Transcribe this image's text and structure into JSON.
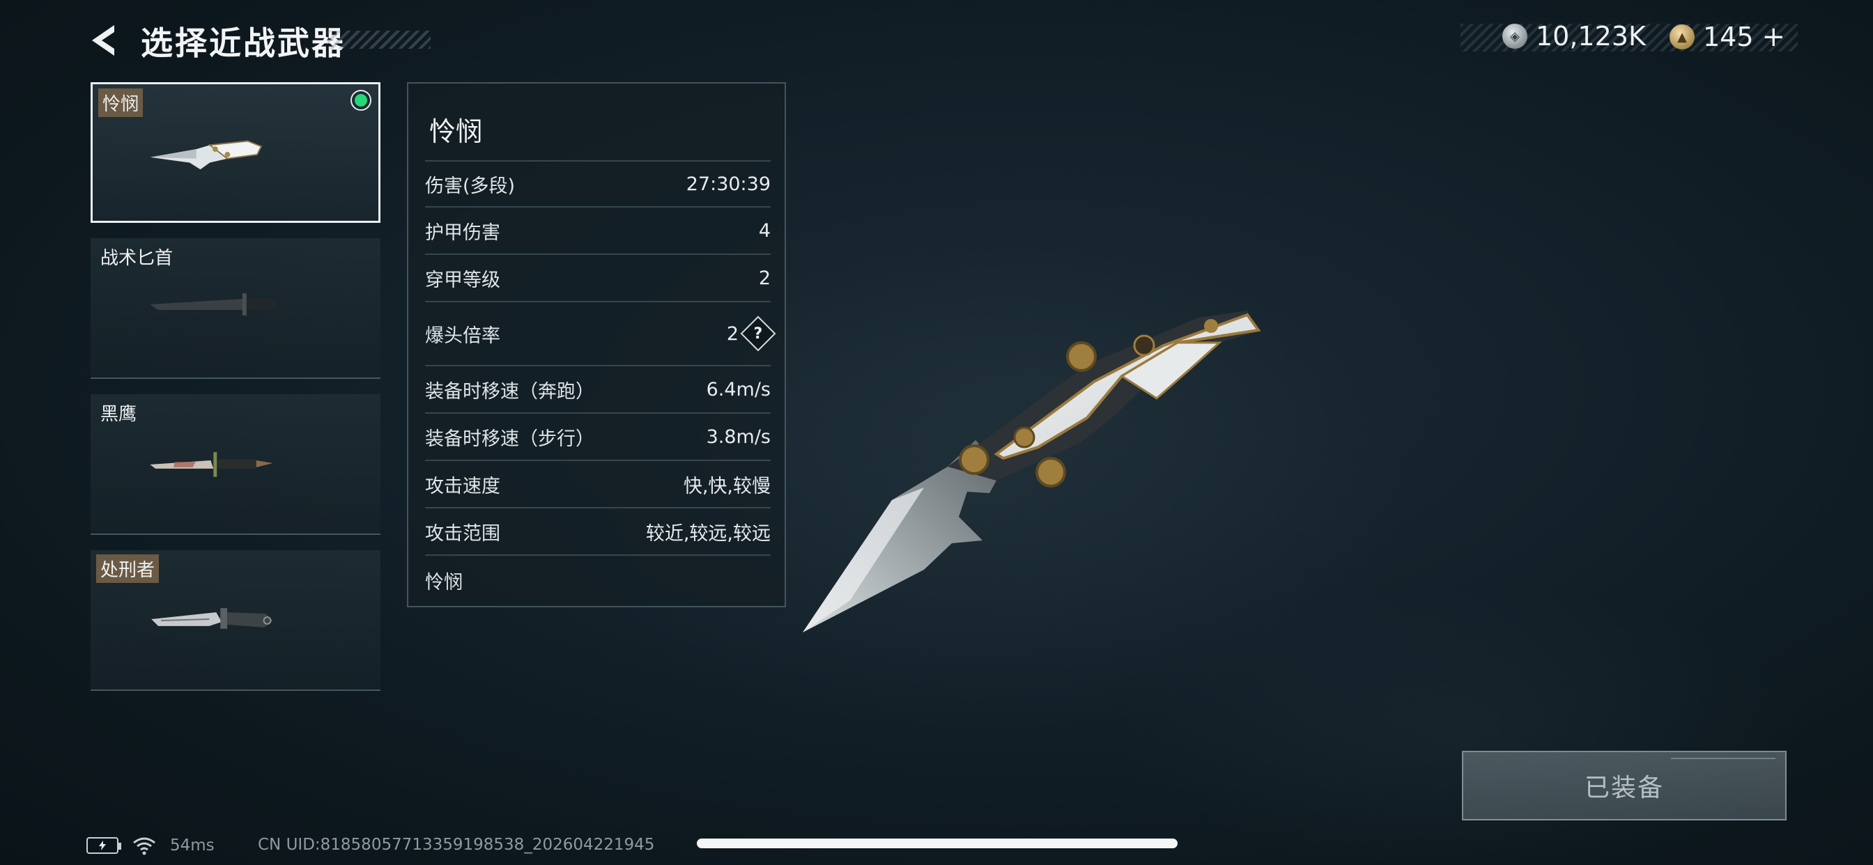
{
  "header": {
    "title": "选择近战武器",
    "back_icon": "back-arrow-icon"
  },
  "currency": {
    "silver": {
      "icon": "silver-coin-icon",
      "amount": "10,123K"
    },
    "gold": {
      "icon": "gold-coin-icon",
      "amount": "145",
      "add_label": "+"
    }
  },
  "weapons": [
    {
      "name": "怜悯",
      "selected": true,
      "equipped": true,
      "tagged": true
    },
    {
      "name": "战术匕首",
      "selected": false,
      "equipped": false,
      "tagged": false
    },
    {
      "name": "黑鹰",
      "selected": false,
      "equipped": false,
      "tagged": false
    },
    {
      "name": "处刑者",
      "selected": false,
      "equipped": false,
      "tagged": true
    }
  ],
  "stats": {
    "name": "怜悯",
    "rows": [
      {
        "label": "伤害(多段)",
        "value": "27:30:39"
      },
      {
        "label": "护甲伤害",
        "value": "4"
      },
      {
        "label": "穿甲等级",
        "value": "2"
      },
      {
        "label": "爆头倍率",
        "value": "2",
        "help": "?"
      },
      {
        "label": "装备时移速（奔跑）",
        "value": "6.4m/s"
      },
      {
        "label": "装备时移速（步行）",
        "value": "3.8m/s"
      },
      {
        "label": "攻击速度",
        "value": "快,快,较慢"
      },
      {
        "label": "攻击范围",
        "value": "较近,较远,较远"
      }
    ],
    "description": "怜悯"
  },
  "equip_button": {
    "label": "已装备",
    "enabled": false
  },
  "status": {
    "battery_icon": "battery-charging-icon",
    "wifi_icon": "wifi-icon",
    "ping": "54ms",
    "uid": "CN UID:81858057713359198538_202604221945"
  },
  "colors": {
    "equipped_dot": "#27d879",
    "tag_bg": "#6b5a44"
  }
}
